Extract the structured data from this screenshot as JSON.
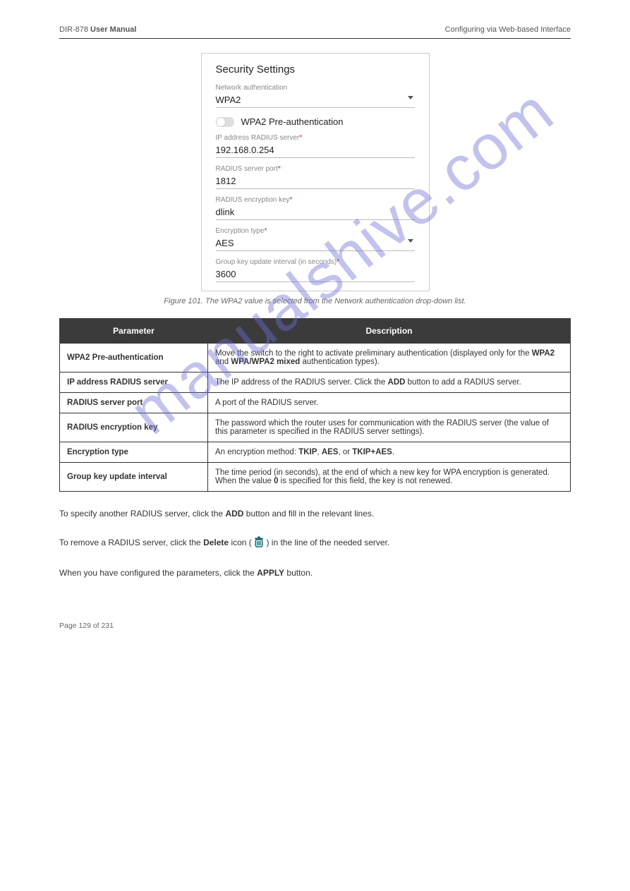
{
  "docHeader": {
    "left": "DIR-878",
    "leftBold": " User Manual",
    "right": "Configuring via Web-based Interface"
  },
  "card": {
    "title": "Security Settings",
    "networkAuthLabel": "Network authentication",
    "networkAuthValue": "WPA2",
    "preauthLabel": "WPA2 Pre-authentication",
    "radiusIpLabel": "IP address RADIUS server",
    "radiusIpValue": "192.168.0.254",
    "radiusPortLabel": "RADIUS server port",
    "radiusPortValue": "1812",
    "radiusKeyLabel": "RADIUS encryption key",
    "radiusKeyValue": "dlink",
    "encTypeLabel": "Encryption type",
    "encTypeValue": "AES",
    "groupKeyLabel": "Group key update interval (in seconds)",
    "groupKeyValue": "3600"
  },
  "caption": "Figure 101. The WPA2 value is selected from the Network authentication drop-down list.",
  "table": {
    "header": {
      "param": "Parameter",
      "desc": "Description"
    },
    "rows": [
      {
        "param": "WPA2 Pre-authentication",
        "desc": "Move the switch to the right to activate preliminary authentication (displayed only for the <b>WPA2</b> and <b>WPA/WPA2 mixed</b> authentication types)."
      },
      {
        "param": "IP address RADIUS server",
        "desc": "The IP address of the RADIUS server. Click the <b>ADD</b> button to add a RADIUS server."
      },
      {
        "param": "RADIUS server port",
        "desc": "A port of the RADIUS server."
      },
      {
        "param": "RADIUS encryption key",
        "desc": "The password which the router uses for communication with the RADIUS server (the value of this parameter is specified in the RADIUS server settings)."
      },
      {
        "param": "Encryption type",
        "desc": "An encryption method: <b>TKIP</b>, <b>AES</b>, or <b>TKIP+AES</b>."
      },
      {
        "param": "Group key update interval",
        "desc": "The time period (in seconds), at the end of which a new key for WPA encryption is generated. When the value <b>0</b> is specified for this field, the key is not renewed."
      }
    ]
  },
  "para1_a": "To specify another RADIUS server, click the ",
  "para1_bold1": "ADD",
  "para1_b": " button and fill in the relevant lines.",
  "para2_a": "To remove a RADIUS server, click the ",
  "para2_bold1": "Delete",
  "para2_b": " icon ( ",
  "para2_c": " ) in the line of the needed server.",
  "para3_a": "When you have configured the parameters, click the ",
  "para3_bold1": "APPLY",
  "para3_b": " button.",
  "footer": {
    "left": "Page 129 of 231",
    "right": ""
  },
  "watermark": "manualshive.com"
}
